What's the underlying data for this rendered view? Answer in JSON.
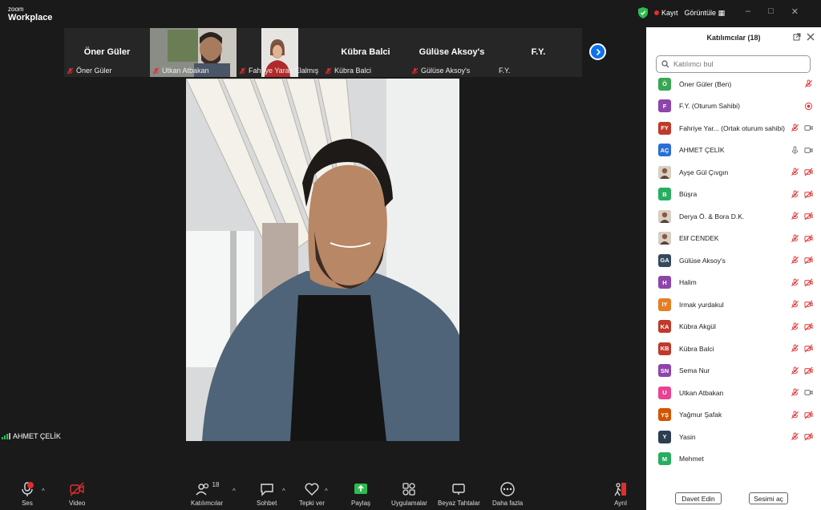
{
  "titlebar": {
    "brand_top": "zoom",
    "brand_bottom": "Workplace",
    "record_label": "Kayıt",
    "view_label": "Görüntüle",
    "window_controls": [
      "–",
      "□",
      "✕"
    ]
  },
  "strip": {
    "tiles": [
      {
        "name": "Öner Güler",
        "label": "Öner Güler",
        "has_video": false
      },
      {
        "name": "Utkan Atbakan",
        "label": "Utkan Atbakan",
        "has_video": true
      },
      {
        "name": "Fahriye Yaraş Elalmış",
        "label": "Fahriye Yaraş Elalmış",
        "has_video": true
      },
      {
        "name": "Kübra Balci",
        "label": "Kübra Balci",
        "has_video": false
      },
      {
        "name": "Gülüse Aksoy's",
        "label": "Gülüse Aksoy's",
        "has_video": false
      },
      {
        "name": "F.Y.",
        "label": "F.Y.",
        "has_video": false
      }
    ],
    "next_icon": "chevron-right-icon"
  },
  "main": {
    "speaker_name": "AHMET ÇELİK"
  },
  "toolbar": {
    "audio_label": "Ses",
    "video_label": "Video",
    "participants_label": "Katılımcılar",
    "participants_count": "18",
    "chat_label": "Sohbet",
    "reactions_label": "Tepki ver",
    "share_label": "Paylaş",
    "apps_label": "Uygulamalar",
    "whiteboard_label": "Beyaz Tahtalar",
    "more_label": "Daha fazla",
    "leave_label": "Ayrıl"
  },
  "panel": {
    "title": "Katılımcılar (18)",
    "search_placeholder": "Katılımcı bul",
    "participants": [
      {
        "initials": "Ö",
        "name": "Öner Güler (Ben)",
        "color": "#3aa655",
        "mic": "muted",
        "video": "none"
      },
      {
        "initials": "F",
        "name": "F.Y. (Oturum Sahibi)",
        "color": "#8e44ad",
        "mic": "none",
        "video": "recording"
      },
      {
        "initials": "FY",
        "name": "Fahriye Yar... (Ortak oturum sahibi)",
        "color": "#c0392b",
        "mic": "muted",
        "video": "on"
      },
      {
        "initials": "AÇ",
        "name": "AHMET ÇELİK",
        "color": "#2a6fd6",
        "mic": "on",
        "video": "on"
      },
      {
        "initials": "",
        "name": "Ayşe Gül Çıvgın",
        "color": "#b5651d",
        "mic": "muted",
        "video": "off"
      },
      {
        "initials": "B",
        "name": "Büşra",
        "color": "#27ae60",
        "mic": "muted",
        "video": "off"
      },
      {
        "initials": "",
        "name": "Derya Ö. & Bora D.K.",
        "color": "#7f8c8d",
        "mic": "muted",
        "video": "off"
      },
      {
        "initials": "",
        "name": "Elif CENDEK",
        "color": "#333333",
        "mic": "muted",
        "video": "off"
      },
      {
        "initials": "GA",
        "name": "Gülüse Aksoy's",
        "color": "#34495e",
        "mic": "muted",
        "video": "off"
      },
      {
        "initials": "H",
        "name": "Halim",
        "color": "#8e44ad",
        "mic": "muted",
        "video": "off"
      },
      {
        "initials": "IY",
        "name": "Irmak yurdakul",
        "color": "#e67e22",
        "mic": "muted",
        "video": "off"
      },
      {
        "initials": "KA",
        "name": "Kübra Akgül",
        "color": "#c0392b",
        "mic": "muted",
        "video": "off"
      },
      {
        "initials": "KB",
        "name": "Kübra Balci",
        "color": "#c0392b",
        "mic": "muted",
        "video": "off"
      },
      {
        "initials": "SN",
        "name": "Sema Nur",
        "color": "#8e44ad",
        "mic": "muted",
        "video": "off"
      },
      {
        "initials": "U",
        "name": "Utkan Atbakan",
        "color": "#e84393",
        "mic": "muted",
        "video": "on"
      },
      {
        "initials": "YŞ",
        "name": "Yağmur Şafak",
        "color": "#d35400",
        "mic": "muted",
        "video": "off"
      },
      {
        "initials": "Y",
        "name": "Yasin",
        "color": "#2c3e50",
        "mic": "muted",
        "video": "off"
      },
      {
        "initials": "M",
        "name": "Mehmet",
        "color": "#27ae60",
        "mic": "none",
        "video": "none"
      }
    ],
    "invite_label": "Davet Edin",
    "unmute_label": "Sesimi aç"
  }
}
